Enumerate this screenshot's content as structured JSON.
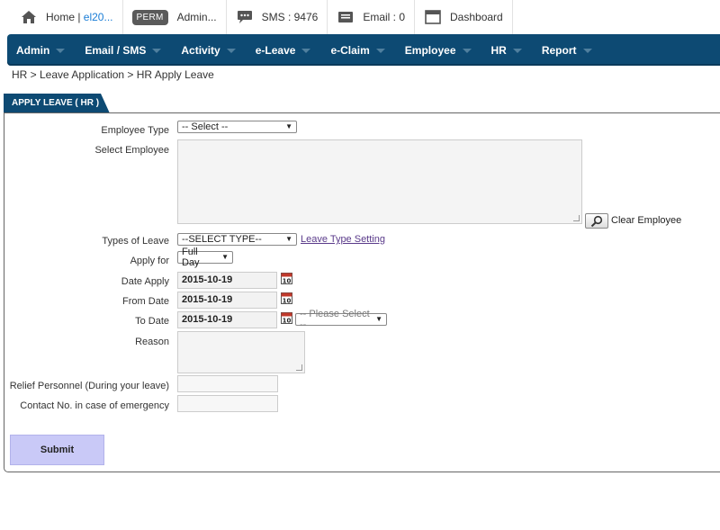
{
  "topbar": {
    "home_label": "Home | ",
    "home_user": "el20...",
    "perm_badge": "PERM",
    "admin_label": "Admin...",
    "sms_label": "SMS : 9476",
    "email_label": "Email : 0",
    "dashboard_label": "Dashboard"
  },
  "nav": {
    "items": [
      "Admin",
      "Email / SMS",
      "Activity",
      "e-Leave",
      "e-Claim",
      "Employee",
      "HR",
      "Report"
    ]
  },
  "breadcrumb": "HR > Leave Application > HR Apply Leave",
  "panel_title": "APPLY LEAVE ( HR )",
  "form": {
    "employee_type_label": "Employee Type",
    "employee_type_value": "-- Select --",
    "select_employee_label": "Select Employee",
    "clear_employee_label": "Clear Employee",
    "types_of_leave_label": "Types of Leave",
    "types_of_leave_value": "--SELECT TYPE--",
    "leave_type_setting_link": "Leave Type Setting",
    "apply_for_label": "Apply for",
    "apply_for_value": "Full Day",
    "date_apply_label": "Date Apply",
    "date_apply_value": "2015-10-19",
    "from_date_label": "From Date",
    "from_date_value": "2015-10-19",
    "to_date_label": "To Date",
    "to_date_value": "2015-10-19",
    "to_date_extra_value": "-- Please Select --",
    "reason_label": "Reason",
    "relief_label": "Relief Personnel (During your leave)",
    "contact_label": "Contact No. in case of emergency",
    "calendar_day": "10",
    "submit_label": "Submit"
  }
}
